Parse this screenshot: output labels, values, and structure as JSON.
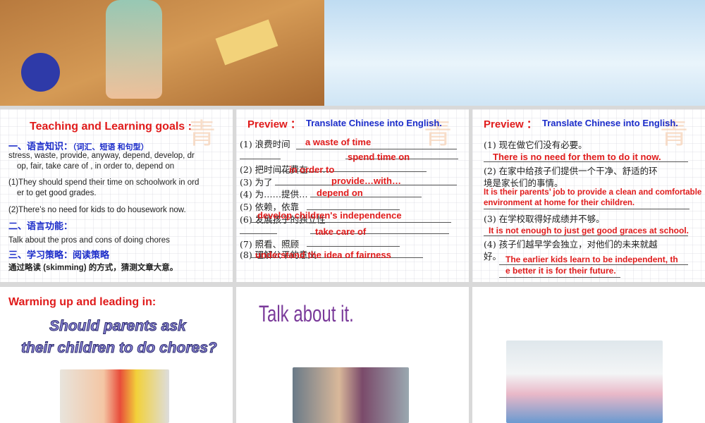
{
  "slide1": {
    "alt": "cartoon cleaning floor"
  },
  "slide2": {
    "title": "Teaching and Learning goals :",
    "h1": "一、语言知识：",
    "h1_sub": "（词汇、短语  和句型）",
    "vocab_line1": "stress, waste, provide, anyway, depend, develop, dr",
    "vocab_line2": "op, fair, take care of , in order to, depend on",
    "s1_line1": "(1)They should spend their time on schoolwork in ord",
    "s1_line2": "er to get good grades.",
    "s2": "(2)There’s no need for kids to do housework now.",
    "h2": "二、语言功能：",
    "func": "Talk about the pros and cons of doing chores",
    "h3": "三、学习策略：阅读策略",
    "strategy": "通过略读 (skimming) 的方式，猜测文章大意。"
  },
  "slide3": {
    "preview": "Preview ：",
    "instr": "Translate Chinese into English.",
    "items": [
      "(1) 浪费时间",
      "(2) 把时间花费在……",
      "(3) 为了",
      "(4) 为……提供…",
      "(5) 依赖，依靠",
      "(6) 发展孩子的独立性",
      "(7) 照看、照顾",
      "(8) 理解公平的意义"
    ],
    "answers": [
      "a waste of time",
      "spend time on",
      "in order to",
      "provide…with…",
      "depend on",
      "develop children's independence",
      "take care of",
      "understand the idea of fairness"
    ]
  },
  "slide4": {
    "preview": "Preview ：",
    "instr": "Translate Chinese into English.",
    "q1": "(1) 现在做它们没有必要。",
    "a1": "There is no need for them to do it now.",
    "q2_line1": "(2) 在家中给孩子们提供一个干净、舒适的环",
    "q2_line2": "境是家长们的事情。",
    "a2_line1": "It is their parents’ job to provide a clean and comfortable",
    "a2_line2": "environment at home for their children.",
    "q3": "(3) 在学校取得好成绩并不够。",
    "a3": "It is not enough to just get good graces at school.",
    "q4_line1": "(4) 孩子们越早学会独立，对他们的未来就越",
    "q4_line2": "好。",
    "a4_line1": "The earlier kids learn to be independent, th",
    "a4_line2": "e better it is for their future."
  },
  "slide5": {
    "title": "Warming up and leading in:",
    "q_line1": "Should parents ask",
    "q_line2": "their children to do chores?"
  },
  "slide6": {
    "title": "Talk about it."
  }
}
